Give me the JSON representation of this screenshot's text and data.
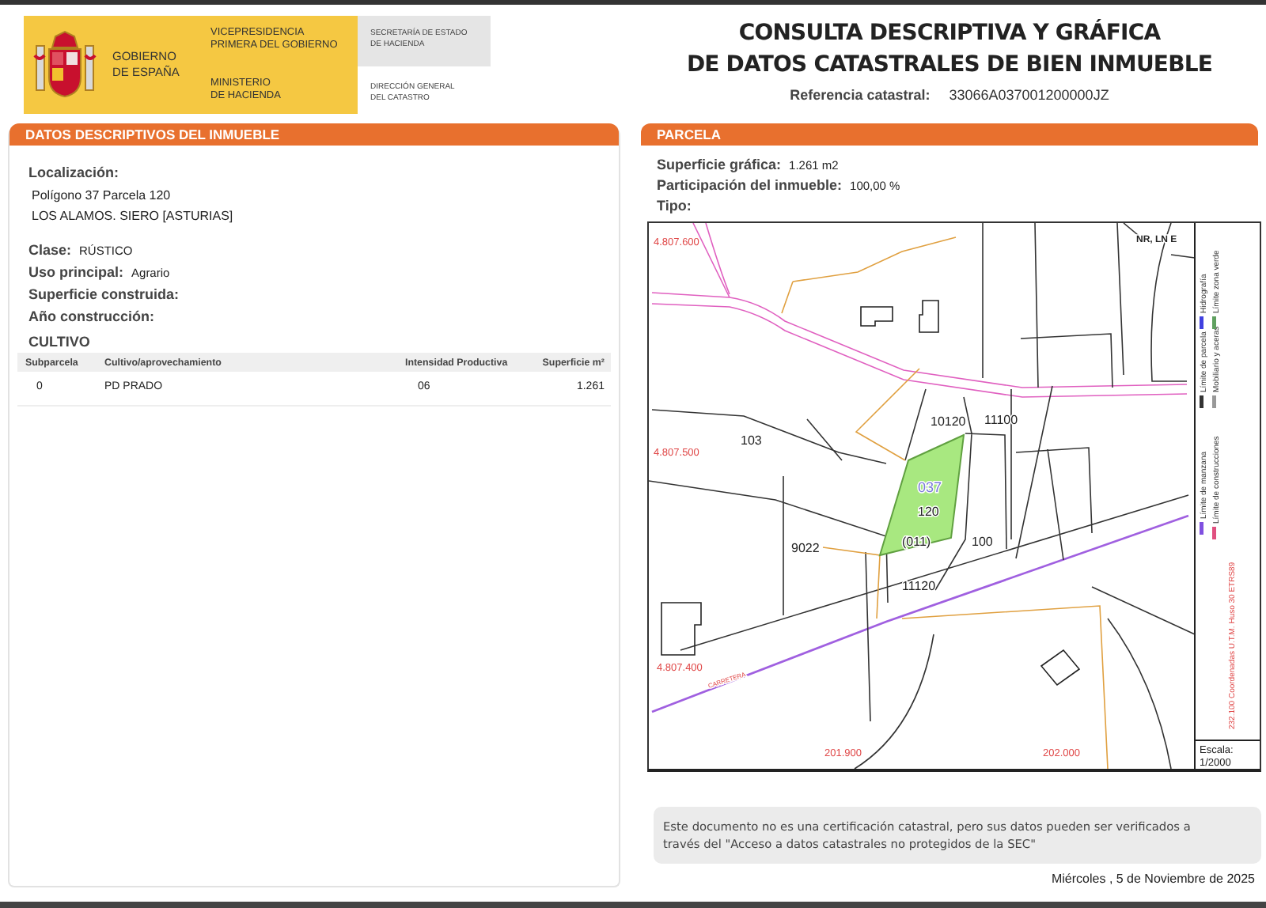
{
  "header": {
    "government": [
      "GOBIERNO",
      "DE ESPAÑA"
    ],
    "vicepresidency": [
      "VICEPRESIDENCIA",
      "PRIMERA DEL GOBIERNO"
    ],
    "ministry": [
      "MINISTERIO",
      "DE HACIENDA"
    ],
    "secretariat": [
      "SECRETARÍA DE ESTADO",
      "DE HACIENDA"
    ],
    "directorate": [
      "DIRECCIÓN GENERAL",
      "DEL CATASTRO"
    ],
    "title": [
      "CONSULTA DESCRIPTIVA Y GRÁFICA",
      "DE DATOS CATASTRALES DE BIEN INMUEBLE"
    ],
    "reference": {
      "label": "Referencia catastral:",
      "value": "33066A037001200000JZ"
    }
  },
  "property_panel": {
    "title": "DATOS DESCRIPTIVOS DEL INMUEBLE",
    "location": {
      "label": "Localización:",
      "lines": [
        "Polígono 37 Parcela 120",
        "LOS ALAMOS. SIERO [ASTURIAS]"
      ]
    },
    "fields": [
      {
        "label": "Clase:",
        "value": "RÚSTICO"
      },
      {
        "label": "Uso principal:",
        "value": "Agrario"
      },
      {
        "label": "Superficie construida:"
      },
      {
        "label": "Año construcción:"
      }
    ],
    "crops": {
      "title": "CULTIVO",
      "columns": [
        "Subparcela",
        "Cultivo/aprovechamiento",
        "Intensidad Productiva",
        "Superficie m²"
      ],
      "rows": [
        [
          "0",
          "PD PRADO",
          "06",
          "1.261"
        ]
      ]
    }
  },
  "parcel_panel": {
    "title": "PARCELA",
    "fields": [
      {
        "label": "Superficie gráfica:",
        "value": "1.261 m2"
      },
      {
        "label": "Participación del inmueble:",
        "value": "100,00 %"
      },
      {
        "label": "Tipo:"
      }
    ],
    "map": {
      "labels": [
        {
          "text": "4.807.600",
          "kind": "coordinate"
        },
        {
          "text": "4.807.500",
          "kind": "coordinate"
        },
        {
          "text": "4.807.400",
          "kind": "coordinate"
        },
        {
          "text": "201.900",
          "kind": "coordinate"
        },
        {
          "text": "202.000",
          "kind": "coordinate"
        },
        {
          "text": "CARRETERA",
          "kind": "road"
        },
        {
          "text": "NR, LN E",
          "kind": "note"
        },
        {
          "text": "103",
          "kind": "parcel"
        },
        {
          "text": "10120",
          "kind": "parcel"
        },
        {
          "text": "11100",
          "kind": "parcel"
        },
        {
          "text": "037",
          "kind": "polygon"
        },
        {
          "text": "120",
          "kind": "parcel"
        },
        {
          "text": "9022",
          "kind": "parcel"
        },
        {
          "text": "(011)",
          "kind": "parcel"
        },
        {
          "text": "100",
          "kind": "parcel"
        },
        {
          "text": "11120",
          "kind": "parcel"
        }
      ],
      "legend": [
        {
          "label": "Límite de parcela",
          "color": "#333333"
        },
        {
          "label": "Hidrografía",
          "color": "#4040e0"
        },
        {
          "label": "Mobiliario y aceras",
          "color": "#999999"
        },
        {
          "label": "Límite zona verde",
          "color": "#60a060"
        },
        {
          "label": "Límite de manzana",
          "color": "#8050e0"
        },
        {
          "label": "Límite de construcciones",
          "color": "#e05080"
        }
      ],
      "projection": "232.100 Coordenadas U.T.M. Huso 30 ETRS89",
      "scale": {
        "label": "Escala:",
        "value": "1/2000"
      }
    },
    "note": [
      "Este documento no es una certificación catastral, pero sus datos pueden ser verificados a",
      "través del \"Acceso a datos catastrales no protegidos de la SEC\""
    ],
    "date": "Miércoles , 5 de Noviembre de 2025"
  }
}
